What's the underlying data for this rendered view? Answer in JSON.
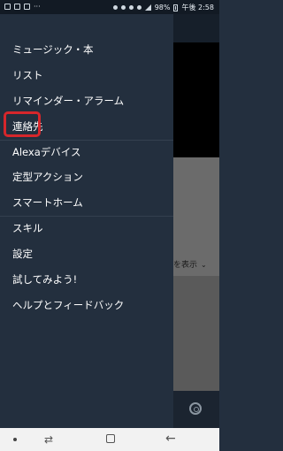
{
  "status_bar": {
    "dots": "···",
    "battery": "98%",
    "time": "午後 2:58"
  },
  "menu": {
    "items": [
      {
        "label": "ミュージック・本"
      },
      {
        "label": "リスト"
      },
      {
        "label": "リマインダー・アラーム"
      },
      {
        "label": "連絡先"
      },
      {
        "label": "Alexaデバイス"
      },
      {
        "label": "定型アクション"
      },
      {
        "label": "スマートホーム"
      },
      {
        "label": "スキル"
      },
      {
        "label": "設定"
      },
      {
        "label": "試してみよう!"
      },
      {
        "label": "ヘルプとフィードバック"
      }
    ],
    "highlighted_item": "連絡先",
    "highlight_color": "#d6262b"
  },
  "background_app": {
    "filter_text": "を表示"
  },
  "colors": {
    "drawer": "#232f3e",
    "status_bar": "#121a24"
  },
  "nav_bar": {
    "recents_icon": "recents-icon",
    "home_icon": "home-icon",
    "back_icon": "back-icon"
  }
}
